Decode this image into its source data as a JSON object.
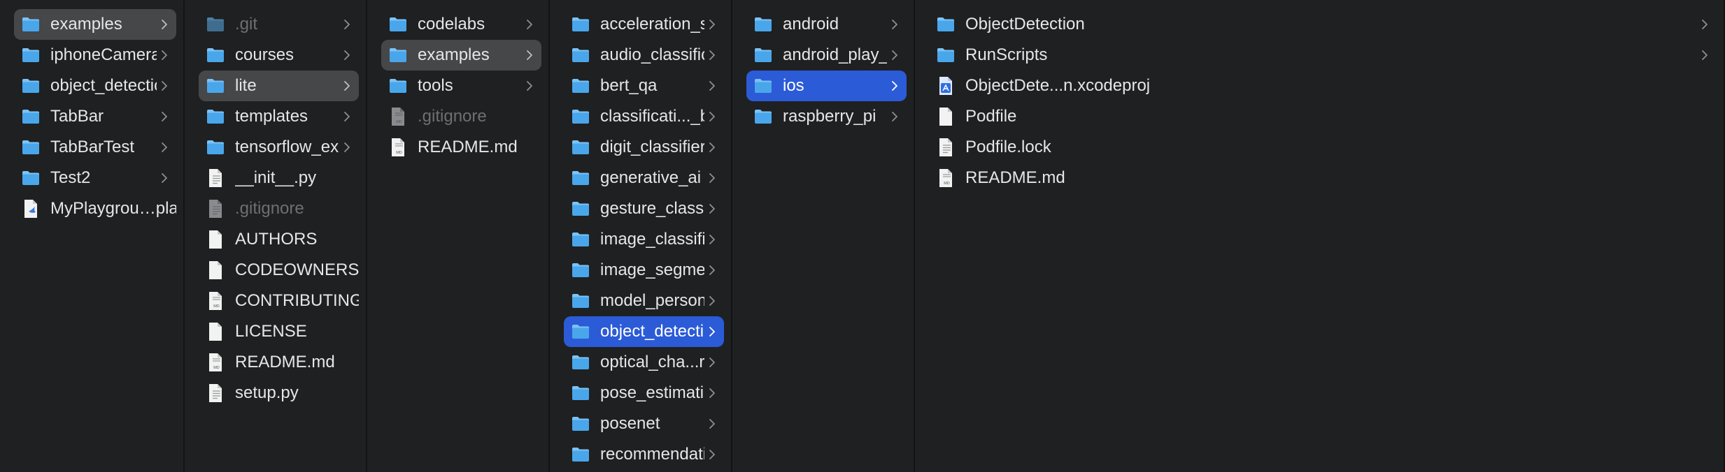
{
  "columns": [
    {
      "items": [
        {
          "label": "examples",
          "type": "folder",
          "arrow": true,
          "selected": "gray"
        },
        {
          "label": "iphoneCameraSample",
          "type": "folder",
          "arrow": true
        },
        {
          "label": "object_detection",
          "type": "folder",
          "arrow": true
        },
        {
          "label": "TabBar",
          "type": "folder",
          "arrow": true
        },
        {
          "label": "TabBarTest",
          "type": "folder",
          "arrow": true
        },
        {
          "label": "Test2",
          "type": "folder",
          "arrow": true
        },
        {
          "label": "MyPlaygrou…playground",
          "type": "swift-playground-file"
        }
      ]
    },
    {
      "items": [
        {
          "label": ".git",
          "type": "folder",
          "arrow": true,
          "dim": true
        },
        {
          "label": "courses",
          "type": "folder",
          "arrow": true
        },
        {
          "label": "lite",
          "type": "folder",
          "arrow": true,
          "selected": "gray"
        },
        {
          "label": "templates",
          "type": "folder",
          "arrow": true
        },
        {
          "label": "tensorflow_examples",
          "type": "folder",
          "arrow": true
        },
        {
          "label": "__init__.py",
          "type": "text-file"
        },
        {
          "label": ".gitignore",
          "type": "text-file",
          "dim": true
        },
        {
          "label": "AUTHORS",
          "type": "blank-file"
        },
        {
          "label": "CODEOWNERS",
          "type": "blank-file"
        },
        {
          "label": "CONTRIBUTING.md",
          "type": "md-file"
        },
        {
          "label": "LICENSE",
          "type": "blank-file"
        },
        {
          "label": "README.md",
          "type": "md-file"
        },
        {
          "label": "setup.py",
          "type": "text-file"
        }
      ]
    },
    {
      "items": [
        {
          "label": "codelabs",
          "type": "folder",
          "arrow": true
        },
        {
          "label": "examples",
          "type": "folder",
          "arrow": true,
          "selected": "gray"
        },
        {
          "label": "tools",
          "type": "folder",
          "arrow": true
        },
        {
          "label": ".gitignore",
          "type": "md-file",
          "dim": true
        },
        {
          "label": "README.md",
          "type": "md-file"
        }
      ]
    },
    {
      "items": [
        {
          "label": "acceleration_service",
          "type": "folder",
          "arrow": true
        },
        {
          "label": "audio_classification",
          "type": "folder",
          "arrow": true
        },
        {
          "label": "bert_qa",
          "type": "folder",
          "arrow": true
        },
        {
          "label": "classificati..._by_retrieval",
          "type": "folder",
          "arrow": true
        },
        {
          "label": "digit_classifier",
          "type": "folder",
          "arrow": true
        },
        {
          "label": "generative_ai",
          "type": "folder",
          "arrow": true
        },
        {
          "label": "gesture_classification",
          "type": "folder",
          "arrow": true
        },
        {
          "label": "image_classification",
          "type": "folder",
          "arrow": true
        },
        {
          "label": "image_segmentation",
          "type": "folder",
          "arrow": true
        },
        {
          "label": "model_personalization",
          "type": "folder",
          "arrow": true
        },
        {
          "label": "object_detection",
          "type": "folder",
          "arrow": true,
          "selected": "blue"
        },
        {
          "label": "optical_cha...recognition",
          "type": "folder",
          "arrow": true
        },
        {
          "label": "pose_estimation",
          "type": "folder",
          "arrow": true
        },
        {
          "label": "posenet",
          "type": "folder",
          "arrow": true
        },
        {
          "label": "recommendation",
          "type": "folder",
          "arrow": true
        }
      ]
    },
    {
      "items": [
        {
          "label": "android",
          "type": "folder",
          "arrow": true
        },
        {
          "label": "android_play_services",
          "type": "folder",
          "arrow": true
        },
        {
          "label": "ios",
          "type": "folder",
          "arrow": true,
          "selected": "blue"
        },
        {
          "label": "raspberry_pi",
          "type": "folder",
          "arrow": true
        }
      ]
    },
    {
      "items": [
        {
          "label": "ObjectDetection",
          "type": "folder",
          "arrow": true
        },
        {
          "label": "RunScripts",
          "type": "folder",
          "arrow": true
        },
        {
          "label": "ObjectDete...n.xcodeproj",
          "type": "xcode-project-file"
        },
        {
          "label": "Podfile",
          "type": "blank-file"
        },
        {
          "label": "Podfile.lock",
          "type": "text-file"
        },
        {
          "label": "README.md",
          "type": "md-file"
        }
      ]
    }
  ],
  "colors": {
    "folder": "#4aa6ea",
    "selected_blue": "#2b5bd7",
    "selected_gray": "#464749"
  }
}
